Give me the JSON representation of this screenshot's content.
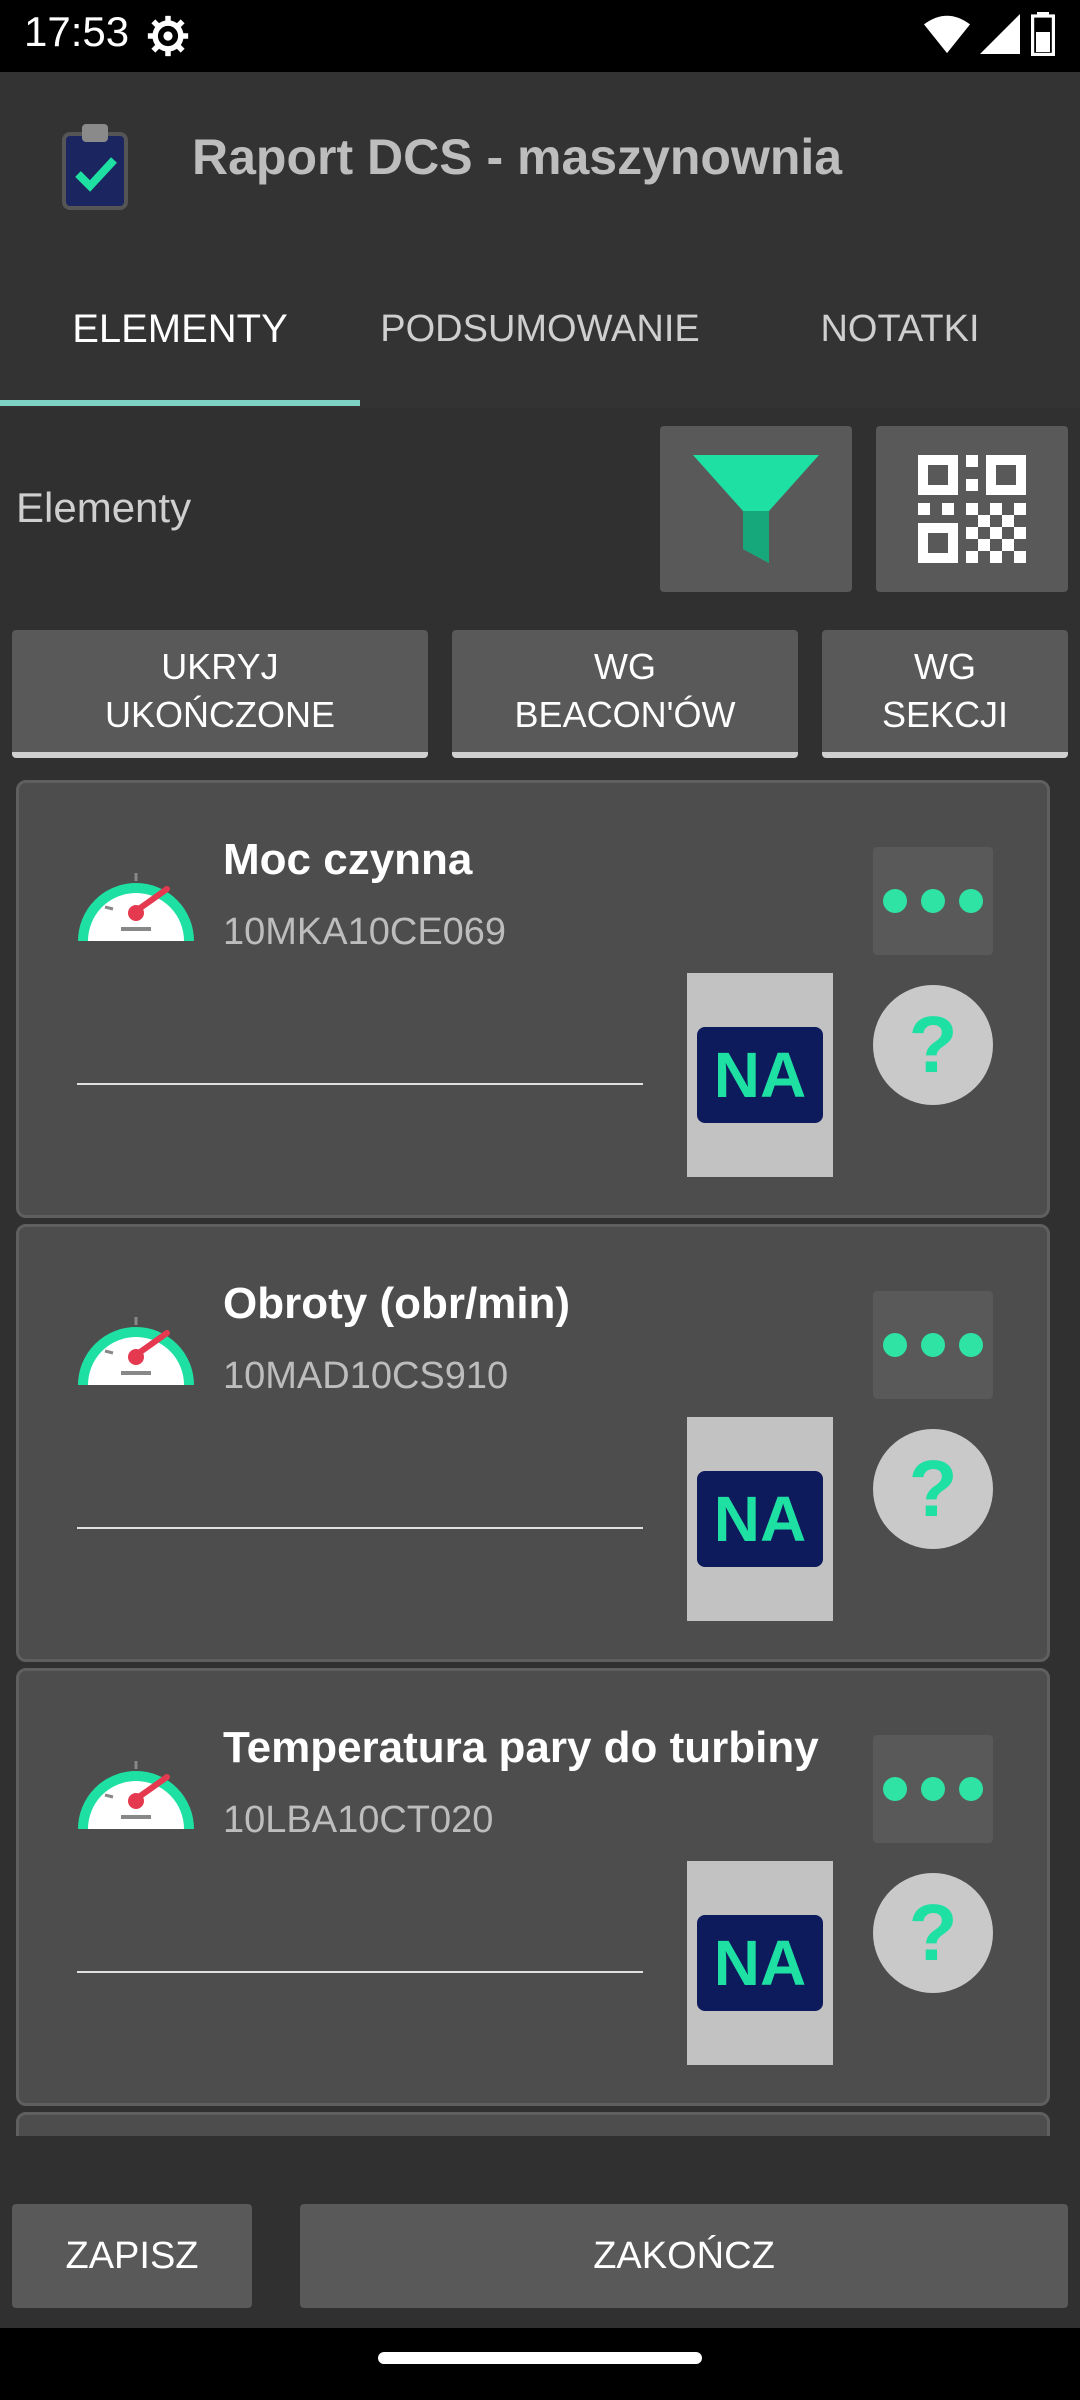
{
  "status_bar": {
    "time": "17:53"
  },
  "app_bar": {
    "title": "Raport DCS - maszynownia"
  },
  "tabs": [
    {
      "label": "ELEMENTY",
      "active": true
    },
    {
      "label": "PODSUMOWANIE",
      "active": false
    },
    {
      "label": "NOTATKI",
      "active": false
    }
  ],
  "filter_section": {
    "label": "Elementy"
  },
  "toggles": [
    {
      "line1": "UKRYJ",
      "line2": "UKOŃCZONE"
    },
    {
      "line1": "WG",
      "line2": "BEACON'ÓW"
    },
    {
      "line1": "WG",
      "line2": "SEKCJI"
    }
  ],
  "items": [
    {
      "title": "Moc czynna",
      "code": "10MKA10CE069",
      "badge": "NA",
      "help": "?"
    },
    {
      "title": "Obroty (obr/min)",
      "code": "10MAD10CS910",
      "badge": "NA",
      "help": "?"
    },
    {
      "title": "Temperatura pary do turbiny",
      "code": "10LBA10CT020",
      "badge": "NA",
      "help": "?"
    }
  ],
  "footer": {
    "save_label": "ZAPISZ",
    "finish_label": "ZAKOŃCZ"
  },
  "colors": {
    "accent": "#1ee0a3",
    "badge_bg": "#0d1a5c",
    "tab_indicator": "#7fd3c5"
  }
}
